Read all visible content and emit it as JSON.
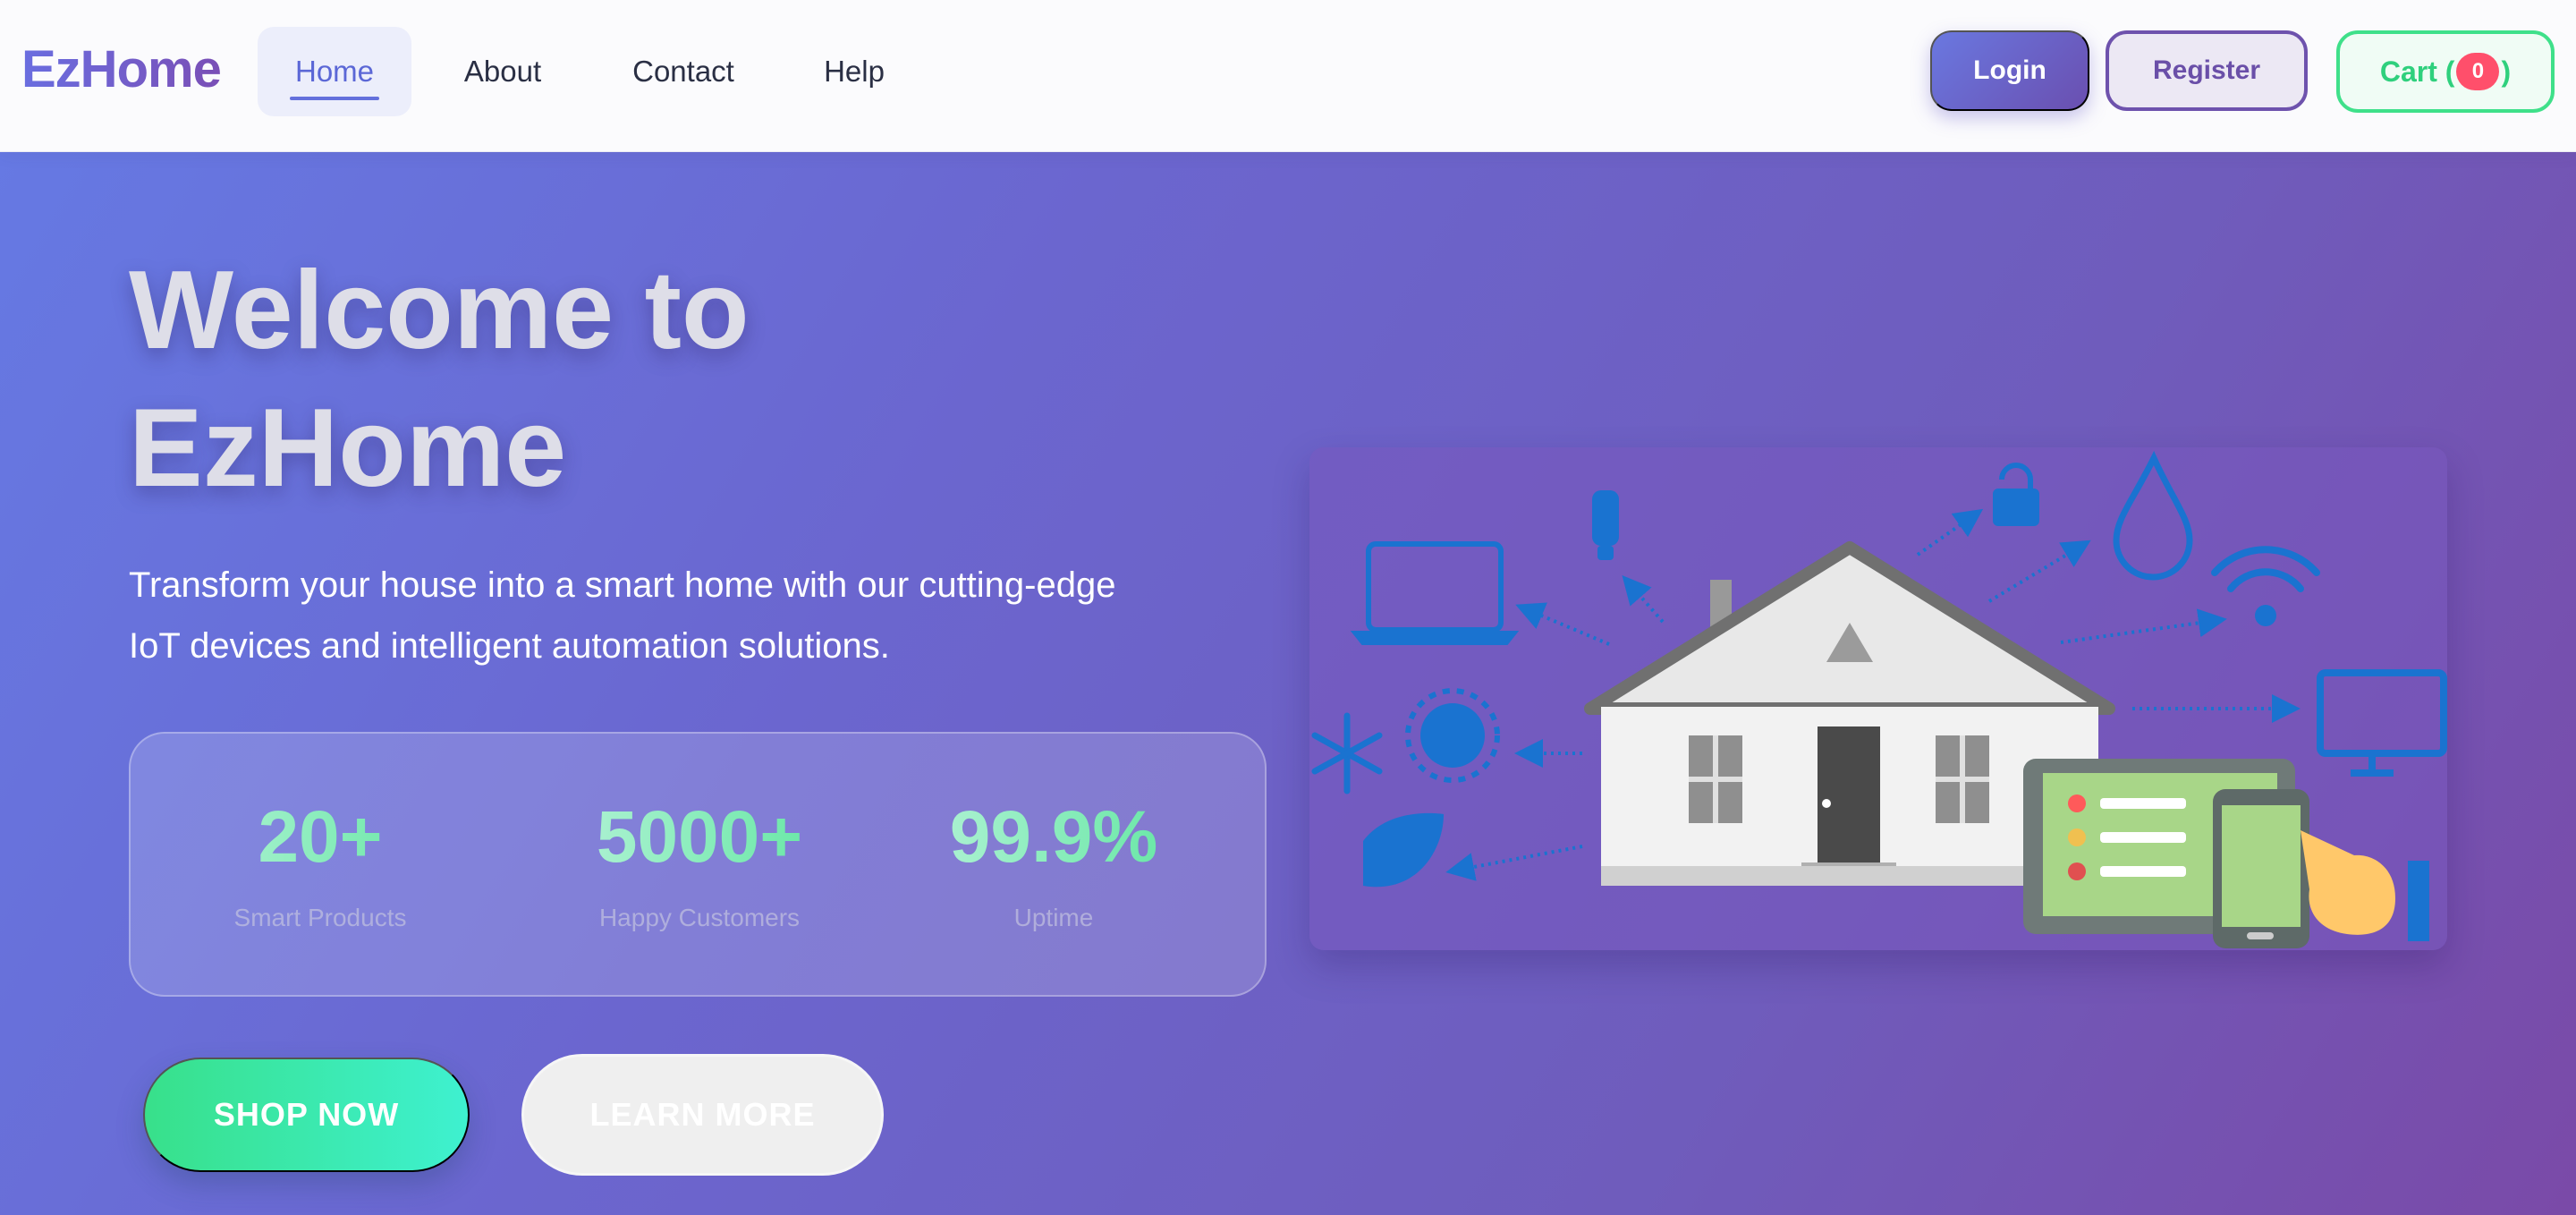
{
  "header": {
    "logo": "EzHome",
    "nav": [
      "Home",
      "About",
      "Contact",
      "Help"
    ],
    "active_nav": "Home",
    "login_label": "Login",
    "register_label": "Register",
    "cart_prefix": "Cart (",
    "cart_count": "0",
    "cart_suffix": ")"
  },
  "hero": {
    "title_line1": "Welcome to",
    "title_line2": "EzHome",
    "subtitle_line1": "Transform your house into a smart home with our cutting-edge",
    "subtitle_line2": "IoT devices and intelligent automation solutions.",
    "stats": [
      {
        "value": "20+",
        "label": "Smart Products"
      },
      {
        "value": "5000+",
        "label": "Happy Customers"
      },
      {
        "value": "99.9%",
        "label": "Uptime"
      }
    ],
    "shop_label": "SHOP NOW",
    "learn_label": "LEARN MORE"
  },
  "colors": {
    "brand": "#6a6ee0",
    "accent_green": "#3fe08a",
    "badge_red": "#ff4f6b",
    "hero_gradient_start": "#6679e3",
    "hero_gradient_end": "#7a4aa8"
  }
}
